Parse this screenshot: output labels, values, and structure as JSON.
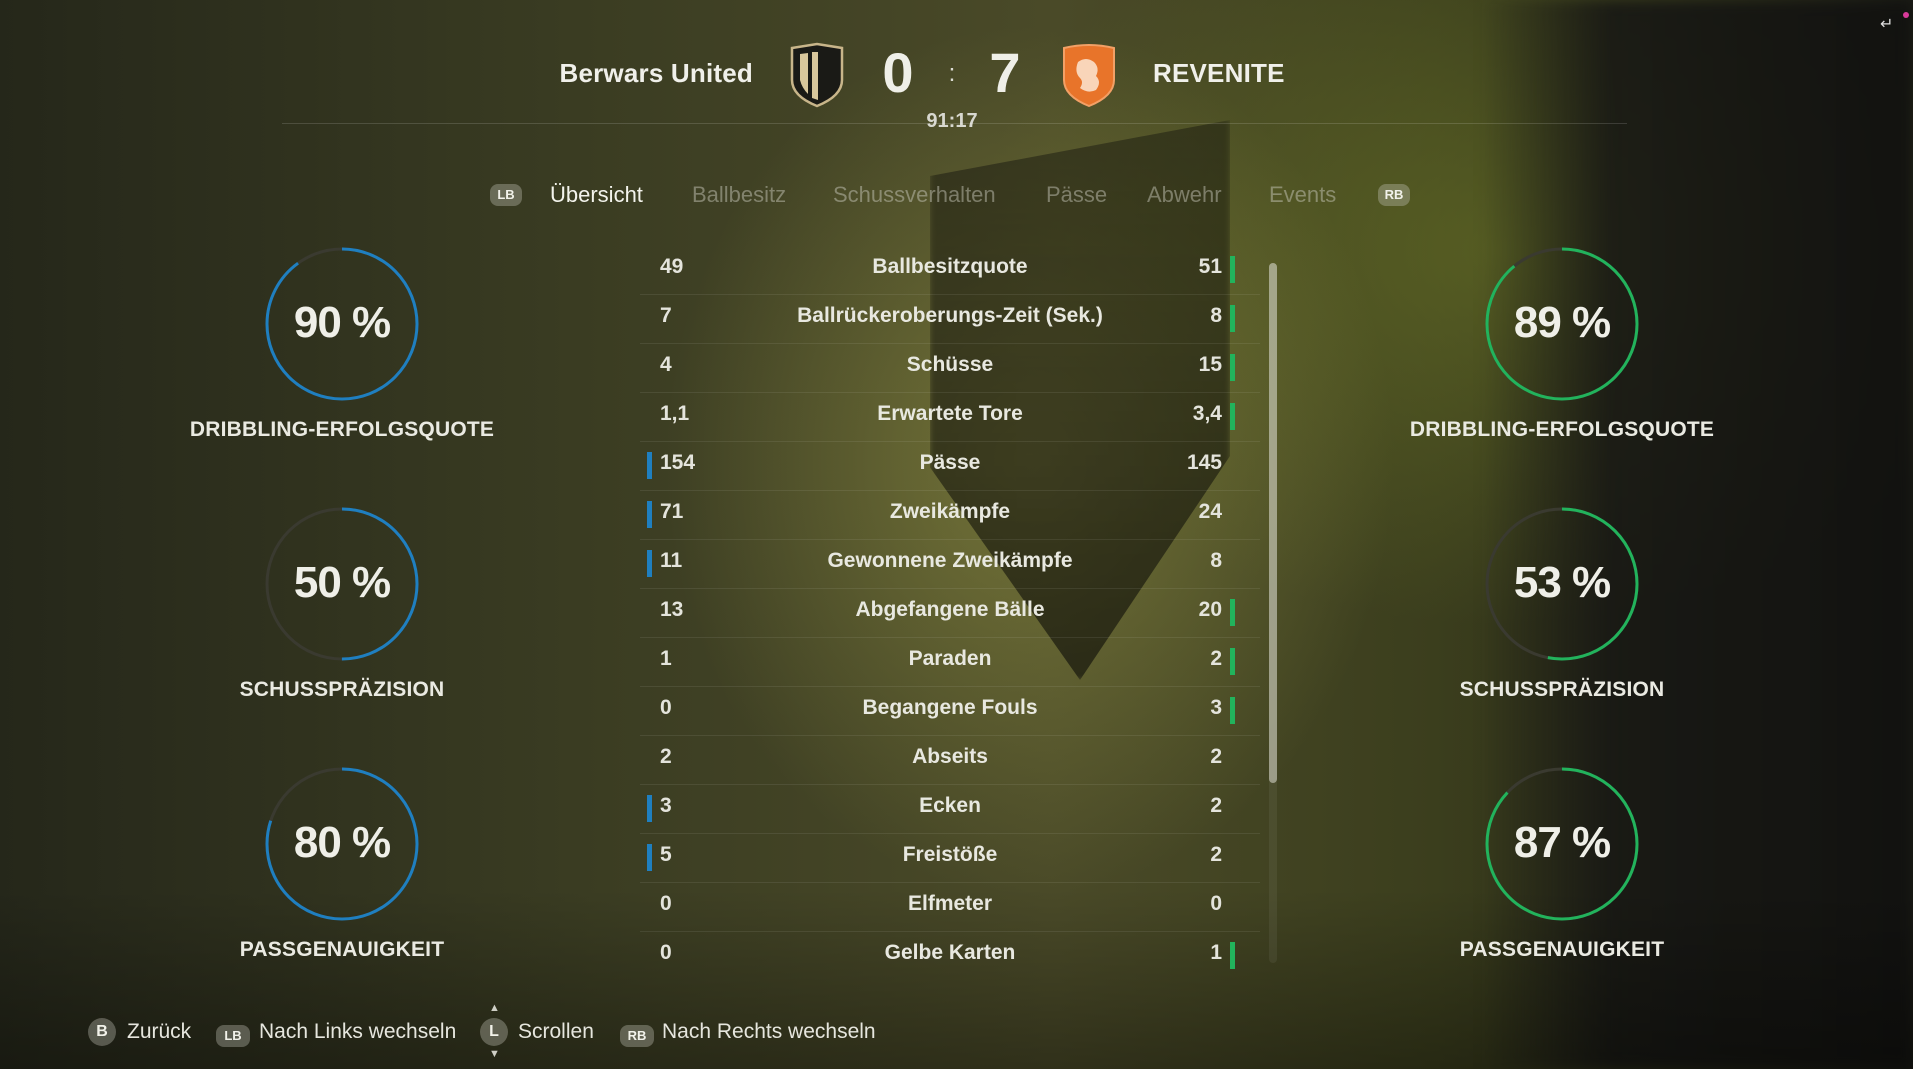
{
  "match": {
    "home_team": "Berwars United",
    "away_team": "REVENITE",
    "home_score": "0",
    "away_score": "7",
    "separator": ":",
    "clock": "91:17"
  },
  "tabs": {
    "lb_badge": "LB",
    "rb_badge": "RB",
    "items": [
      {
        "label": "Übersicht",
        "active": true
      },
      {
        "label": "Ballbesitz",
        "active": false
      },
      {
        "label": "Schussverhalten",
        "active": false
      },
      {
        "label": "Pässe",
        "active": false
      },
      {
        "label": "Abwehr",
        "active": false
      },
      {
        "label": "Events",
        "active": false
      }
    ]
  },
  "home_gauges": [
    {
      "value": "90 %",
      "fraction": 0.9,
      "label": "DRIBBLING-ERFOLGSQUOTE"
    },
    {
      "value": "50 %",
      "fraction": 0.5,
      "label": "SCHUSSPRÄZISION"
    },
    {
      "value": "80 %",
      "fraction": 0.8,
      "label": "PASSGENAUIGKEIT"
    }
  ],
  "away_gauges": [
    {
      "value": "89 %",
      "fraction": 0.89,
      "label": "DRIBBLING-ERFOLGSQUOTE"
    },
    {
      "value": "53 %",
      "fraction": 0.53,
      "label": "SCHUSSPRÄZISION"
    },
    {
      "value": "87 %",
      "fraction": 0.87,
      "label": "PASSGENAUIGKEIT"
    }
  ],
  "stats": [
    {
      "home": "49",
      "name": "Ballbesitzquote",
      "away": "51",
      "leader": "away"
    },
    {
      "home": "7",
      "name": "Ballrückeroberungs-Zeit (Sek.)",
      "away": "8",
      "leader": "away"
    },
    {
      "home": "4",
      "name": "Schüsse",
      "away": "15",
      "leader": "away"
    },
    {
      "home": "1,1",
      "name": "Erwartete Tore",
      "away": "3,4",
      "leader": "away"
    },
    {
      "home": "154",
      "name": "Pässe",
      "away": "145",
      "leader": "home"
    },
    {
      "home": "71",
      "name": "Zweikämpfe",
      "away": "24",
      "leader": "home"
    },
    {
      "home": "11",
      "name": "Gewonnene Zweikämpfe",
      "away": "8",
      "leader": "home"
    },
    {
      "home": "13",
      "name": "Abgefangene Bälle",
      "away": "20",
      "leader": "away"
    },
    {
      "home": "1",
      "name": "Paraden",
      "away": "2",
      "leader": "away"
    },
    {
      "home": "0",
      "name": "Begangene Fouls",
      "away": "3",
      "leader": "away"
    },
    {
      "home": "2",
      "name": "Abseits",
      "away": "2",
      "leader": "none"
    },
    {
      "home": "3",
      "name": "Ecken",
      "away": "2",
      "leader": "home"
    },
    {
      "home": "5",
      "name": "Freistöße",
      "away": "2",
      "leader": "home"
    },
    {
      "home": "0",
      "name": "Elfmeter",
      "away": "0",
      "leader": "none"
    },
    {
      "home": "0",
      "name": "Gelbe Karten",
      "away": "1",
      "leader": "away"
    }
  ],
  "footer": {
    "back_badge": "B",
    "back_label": "Zurück",
    "left_badge": "LB",
    "left_label": "Nach Links wechseln",
    "scroll_badge": "L",
    "scroll_label": "Scrollen",
    "right_badge": "RB",
    "right_label": "Nach Rechts wechseln"
  },
  "colors": {
    "home_accent": "#1f7fc0",
    "away_accent": "#22b35c",
    "gauge_track": "#3a3a30"
  },
  "icons": {
    "exit": "exit-icon",
    "home_crest": "shield-crest-icon",
    "away_crest": "lion-crest-icon"
  }
}
